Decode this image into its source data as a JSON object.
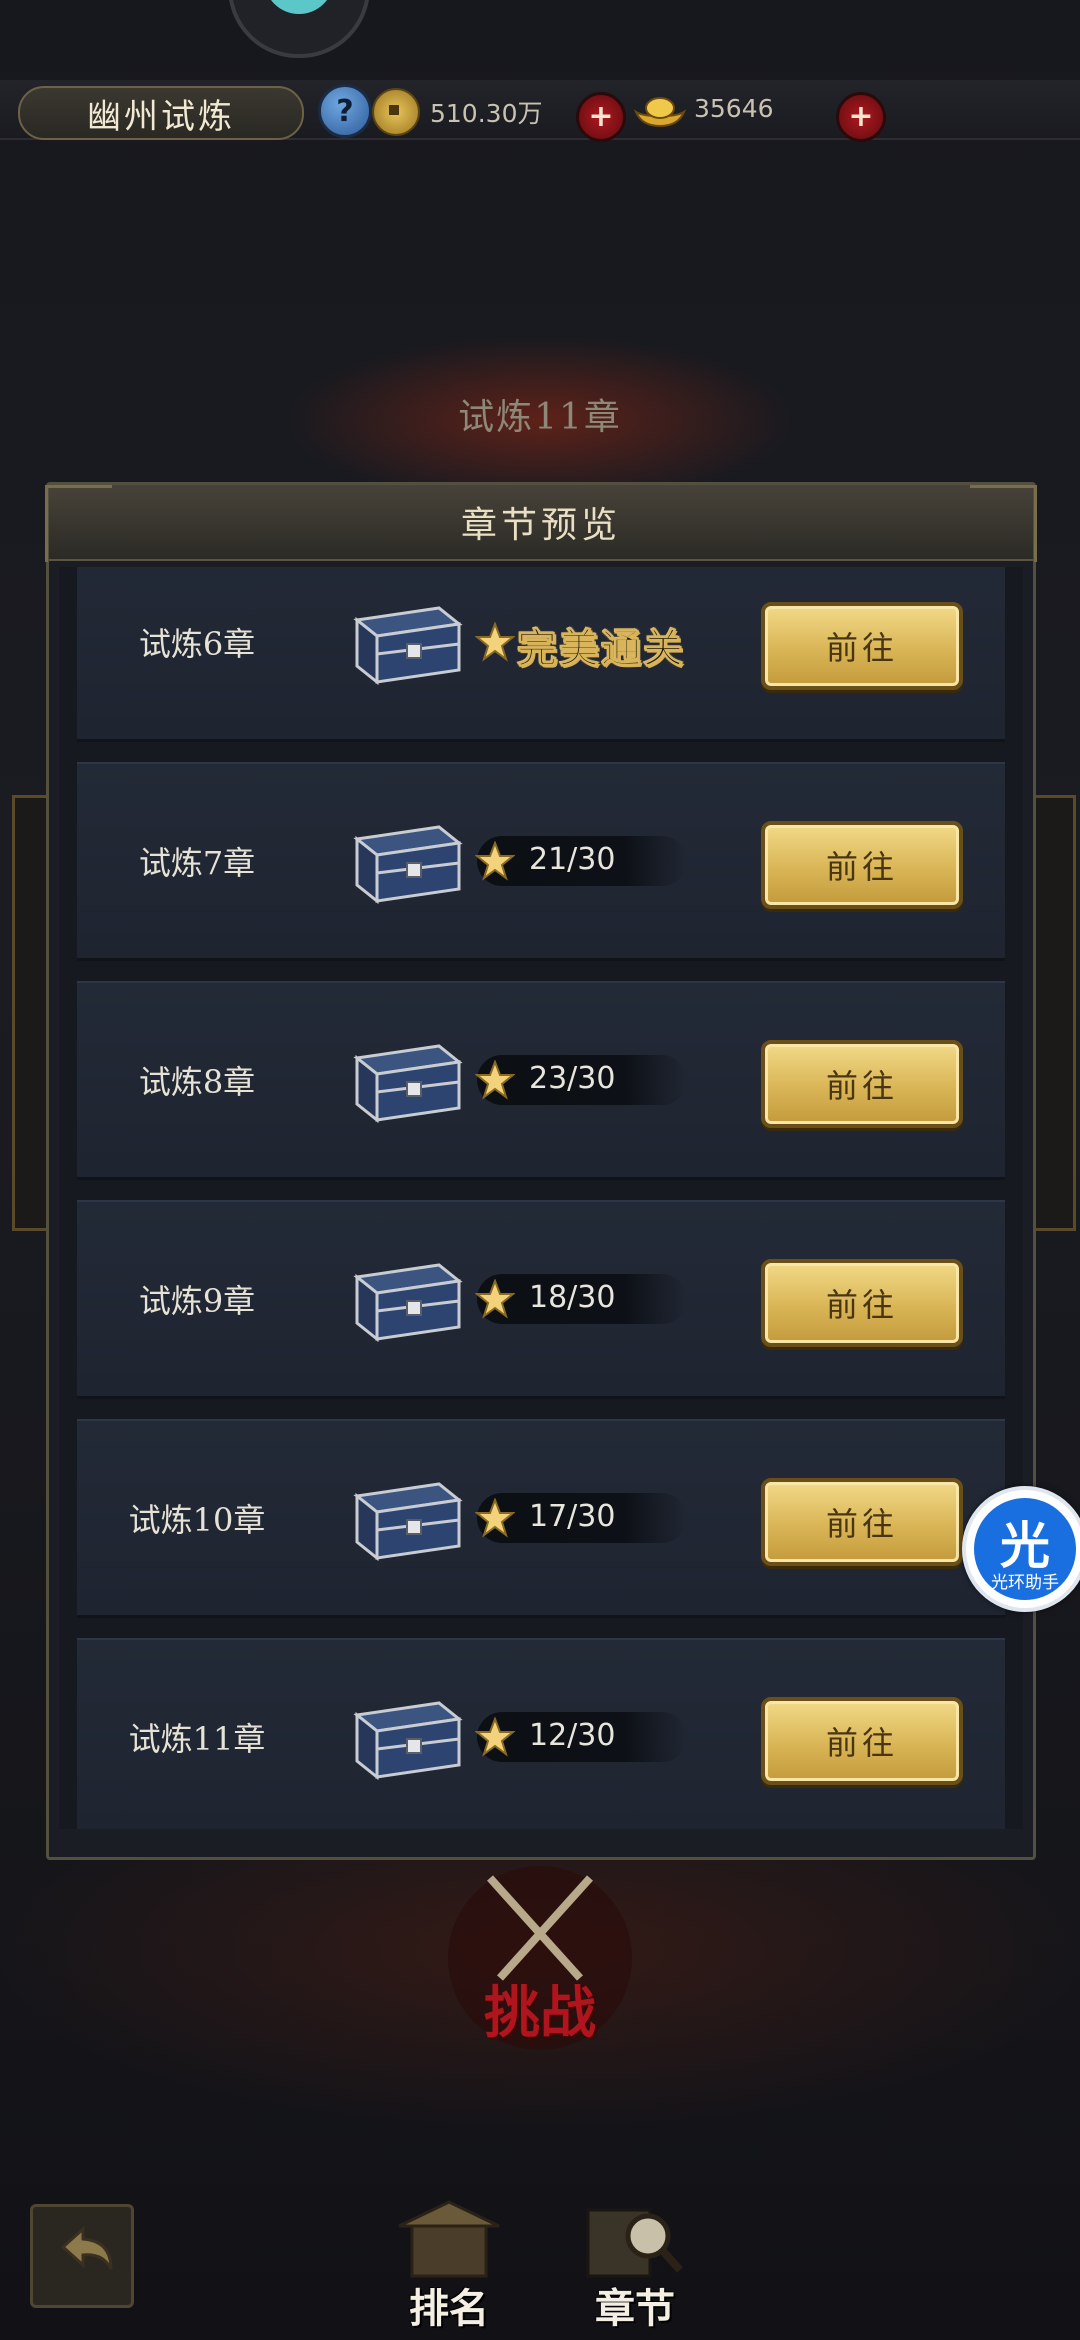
{
  "header": {
    "title": "幽州试炼",
    "coins": "510.30万",
    "gold": "35646"
  },
  "chapter_header": "试炼11章",
  "modal": {
    "title": "章节预览",
    "rows": [
      {
        "label": "试炼6章",
        "status": "完美通关",
        "progress": "",
        "button": "前往"
      },
      {
        "label": "试炼7章",
        "status": "",
        "progress": "21/30",
        "button": "前往"
      },
      {
        "label": "试炼8章",
        "status": "",
        "progress": "23/30",
        "button": "前往"
      },
      {
        "label": "试炼9章",
        "status": "",
        "progress": "18/30",
        "button": "前往"
      },
      {
        "label": "试炼10章",
        "status": "",
        "progress": "17/30",
        "button": "前往"
      },
      {
        "label": "试炼11章",
        "status": "",
        "progress": "12/30",
        "button": "前往"
      }
    ]
  },
  "assistant": {
    "glyph": "光",
    "label": "光环助手"
  },
  "challenge": {
    "label": "挑战"
  },
  "nav": {
    "ranking": "排名",
    "chapter": "章节"
  },
  "colors": {
    "accent_gold": "#d9b556",
    "danger_red": "#b01820",
    "panel": "#1e2430"
  }
}
